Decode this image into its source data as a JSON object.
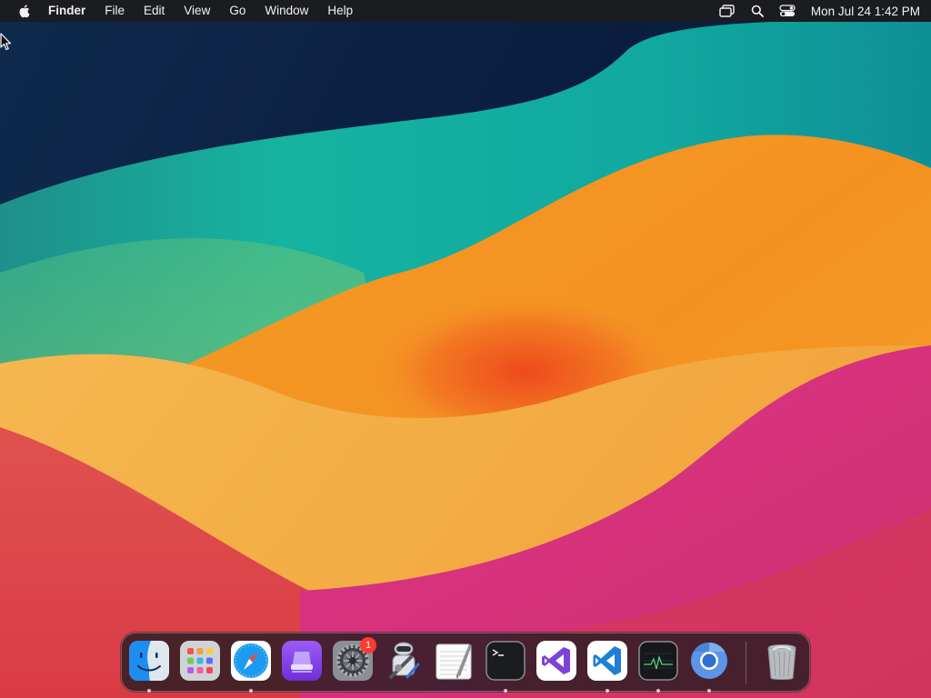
{
  "menubar": {
    "app_name": "Finder",
    "menus": [
      "File",
      "Edit",
      "View",
      "Go",
      "Window",
      "Help"
    ],
    "clock": "Mon Jul 24  1:42 PM"
  },
  "dock": {
    "apps": [
      {
        "id": "finder",
        "label": "Finder",
        "icon": "finder-icon",
        "running": true
      },
      {
        "id": "launchpad",
        "label": "Launchpad",
        "icon": "launchpad-icon",
        "running": false
      },
      {
        "id": "safari",
        "label": "Safari",
        "icon": "safari-icon",
        "running": true
      },
      {
        "id": "podcasts",
        "label": "App",
        "icon": "purple-app-icon",
        "running": false
      },
      {
        "id": "system-settings",
        "label": "System Settings",
        "icon": "gear-icon",
        "running": false,
        "badge": "1"
      },
      {
        "id": "automator",
        "label": "Automator",
        "icon": "automator-icon",
        "running": false
      },
      {
        "id": "textedit",
        "label": "TextEdit",
        "icon": "textedit-icon",
        "running": false
      },
      {
        "id": "terminal",
        "label": "Terminal",
        "icon": "terminal-icon",
        "running": true
      },
      {
        "id": "visual-studio",
        "label": "Visual Studio",
        "icon": "visual-studio-icon",
        "running": false
      },
      {
        "id": "vscode",
        "label": "Visual Studio Code",
        "icon": "vscode-icon",
        "running": true
      },
      {
        "id": "activity-monitor",
        "label": "Activity Monitor",
        "icon": "activity-monitor-icon",
        "running": true
      },
      {
        "id": "chromium",
        "label": "Chromium",
        "icon": "chromium-icon",
        "running": true
      },
      {
        "id": "trash",
        "label": "Trash",
        "icon": "trash-icon",
        "running": false
      }
    ]
  },
  "colors": {
    "menubar_bg": "#1a1c20",
    "badge": "#ff3b30"
  }
}
